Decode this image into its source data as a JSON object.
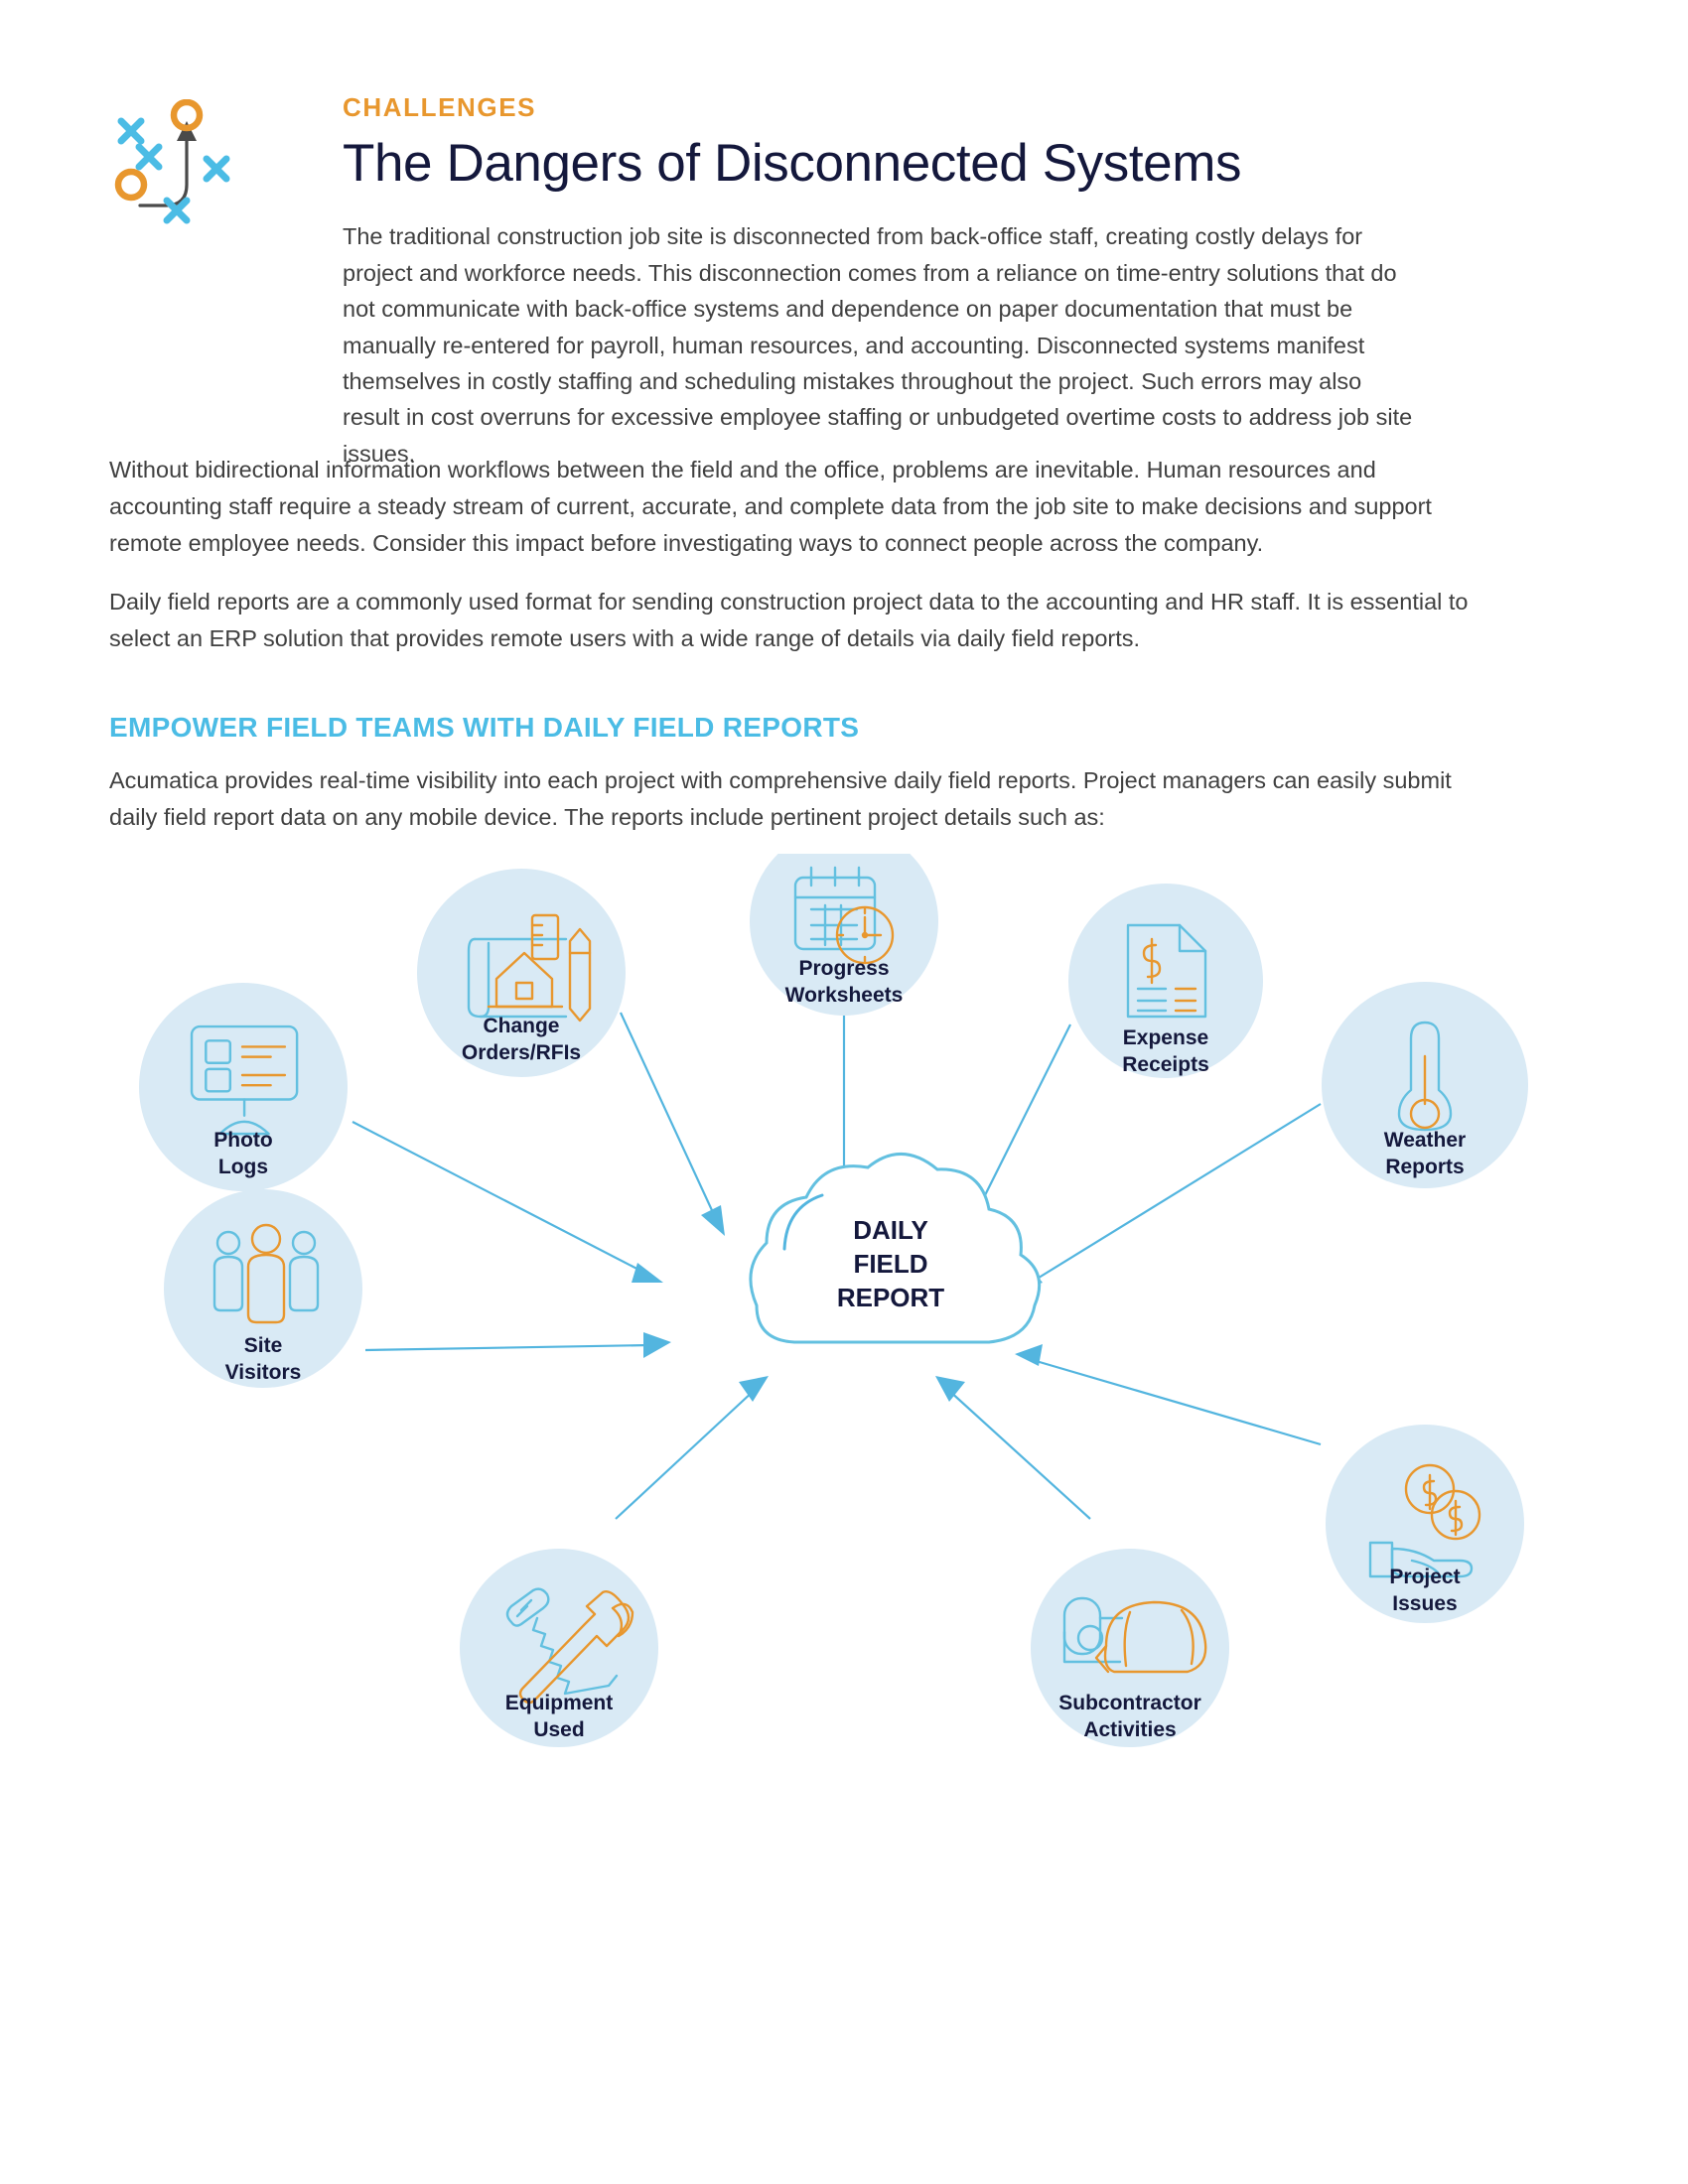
{
  "header": {
    "eyebrow": "CHALLENGES",
    "title": "The Dangers of Disconnected Systems",
    "icon_name": "xs-and-os-strategy-icon",
    "accent_orange": "#E8972E",
    "accent_blue": "#4BBCE5",
    "title_color": "#14183c"
  },
  "paragraphs": {
    "intro": "The traditional construction job site is disconnected from back-office staff, creating costly delays for project and workforce needs. This disconnection comes from a reliance on time-entry solutions that do not communicate with back-office systems and dependence on paper documentation that must be manually re-entered for payroll, human resources, and accounting. Disconnected systems manifest themselves in costly staffing and scheduling mistakes throughout the project. Such errors may also result in cost overruns for excessive employee staffing or unbudgeted overtime costs to address job site issues.",
    "second": "Without bidirectional information workflows between the field and the office, problems are inevitable. Human resources and accounting staff require a steady stream of current, accurate, and complete data from the job site to make decisions and support remote employee needs. Consider this impact before investigating ways to connect people across the company.",
    "third": "Daily field reports are a commonly used format for sending construction project data to the accounting and HR staff. It is essential to select an ERP solution that provides remote users with a wide range of details via daily field reports."
  },
  "section": {
    "heading": "EMPOWER FIELD TEAMS WITH DAILY FIELD REPORTS",
    "body": "Acumatica provides real-time visibility into each project with comprehensive daily field reports. Project managers can easily submit daily field report data on any mobile device. The reports include pertinent project details such as:"
  },
  "diagram": {
    "center": {
      "label_line1": "DAILY",
      "label_line2": "FIELD",
      "label_line3": "REPORT",
      "shape": "cloud"
    },
    "nodes": [
      {
        "id": "photo-logs",
        "label_line1": "Photo",
        "label_line2": "Logs",
        "icon": "monitor-list-icon"
      },
      {
        "id": "change-orders",
        "label_line1": "Change",
        "label_line2": "Orders/RFIs",
        "icon": "blueprint-ruler-pencil-icon"
      },
      {
        "id": "progress-worksheets",
        "label_line1": "Progress",
        "label_line2": "Worksheets",
        "icon": "calendar-clock-icon"
      },
      {
        "id": "expense-receipts",
        "label_line1": "Expense",
        "label_line2": "Receipts",
        "icon": "receipt-dollar-icon"
      },
      {
        "id": "weather-reports",
        "label_line1": "Weather",
        "label_line2": "Reports",
        "icon": "thermometer-icon"
      },
      {
        "id": "project-issues",
        "label_line1": "Project",
        "label_line2": "Issues",
        "icon": "hand-coins-icon"
      },
      {
        "id": "subcontractor-activities",
        "label_line1": "Subcontractor",
        "label_line2": "Activities",
        "icon": "hardhat-clipboard-icon"
      },
      {
        "id": "equipment-used",
        "label_line1": "Equipment",
        "label_line2": "Used",
        "icon": "hammer-saw-icon"
      },
      {
        "id": "site-visitors",
        "label_line1": "Site",
        "label_line2": "Visitors",
        "icon": "three-people-icon"
      }
    ],
    "colors": {
      "node_fill": "#D9EAF5",
      "arrow": "#53B5DF",
      "icon_blue": "#63C0E0",
      "icon_orange": "#E8972E",
      "label": "#14183c"
    }
  }
}
